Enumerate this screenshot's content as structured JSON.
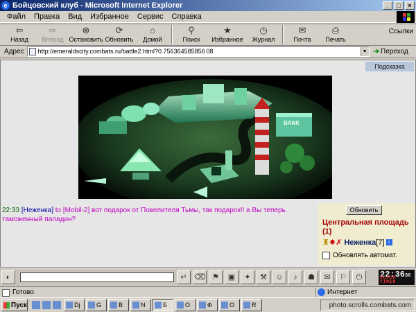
{
  "window": {
    "title": "Бойцовский клуб - Microsoft Internet Explorer"
  },
  "menu": [
    "Файл",
    "Правка",
    "Вид",
    "Избранное",
    "Сервис",
    "Справка"
  ],
  "toolbar": {
    "back": "Назад",
    "forward": "Вперед",
    "stop": "Остановить",
    "refresh": "Обновить",
    "home": "Домой",
    "search": "Поиск",
    "favorites": "Избранное",
    "history": "Журнал",
    "mail": "Почта",
    "print": "Печать",
    "links": "Ссылки"
  },
  "address": {
    "label": "Адрес",
    "url": "http://emeraldscity.combats.ru/battle2.html?0.756364585856 08",
    "go": "Переход"
  },
  "content": {
    "hint": "Подсказка",
    "bank_sign": "BANK",
    "chat": {
      "time": "22:33",
      "from": "[Неженка]",
      "to_word": "to",
      "to": "[Mobil-2]",
      "message": "вот подарок от Повелителя Тьмы, так подарок!! а Вы теперь таможенный паладин?"
    },
    "side": {
      "refresh_button": "Обновить",
      "location": "Центральная площадь (1)",
      "user_name": "Неженка",
      "user_level": "[7]",
      "info_badge": "i",
      "auto_refresh_label": "Обновлять автомат."
    }
  },
  "clock": {
    "time": "22:36",
    "seconds": "36",
    "label": "CLOCK TIMER"
  },
  "status": {
    "left": "Готово",
    "zone": "Интернет"
  },
  "taskbar": {
    "start": "Пуск",
    "tasks": [
      "Dj",
      "G",
      "B",
      "N",
      "Б",
      "O",
      "Ф",
      "O",
      "R",
      "n"
    ],
    "tray_text": "photo.scrolls.combats.com"
  }
}
